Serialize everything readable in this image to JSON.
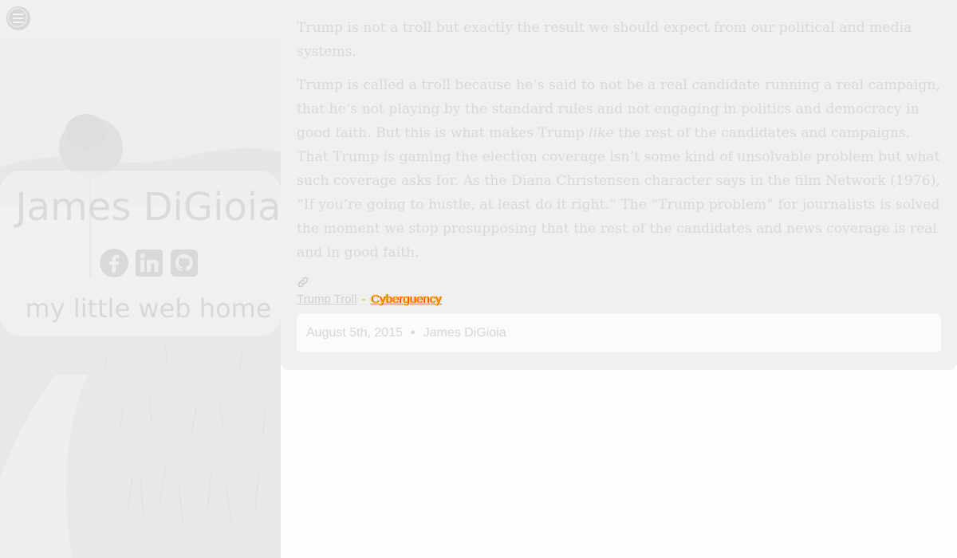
{
  "site": {
    "name": "James DiGioia",
    "tagline": "my little web home",
    "social": [
      {
        "network": "Facebook",
        "icon": "facebook-icon"
      },
      {
        "network": "LinkedIn",
        "icon": "linkedin-icon"
      },
      {
        "network": "GitHub",
        "icon": "github-icon"
      }
    ],
    "menu_icon": "hamburger-menu-icon"
  },
  "post": {
    "paragraphs": [
      {
        "text": "Trump is not a troll but exactly the result we should expect from our political and media systems."
      },
      {
        "before": "Trump is called a troll because he’s said to not be a real candidate running a real campaign, that he’s not playing by the standard rules and not engaging in politics and democracy in good faith. But this is what makes Trump ",
        "emphasis": "like",
        "after": " the rest of the candidates and campaigns. That Trump is gaming the election coverage isn’t some kind of unsolvable problem but what such coverage asks for. As the Diana Christensen character says in the film Network (1976), “If you’re going to hustle, at least do it right.” The “Trump problem” for journalists is solved the moment we stop presupposing that the rest of the candidates and news coverage is real and in good faith."
      }
    ],
    "permalink_icon": "link-icon",
    "tags": [
      {
        "label": "Trump Troll"
      },
      {
        "label": "Cyberguency"
      }
    ],
    "tag_separator": " - ",
    "meta": {
      "date": "August 5th, 2015",
      "separator": "•",
      "author": "James DiGioia"
    }
  },
  "colors": {
    "hero_overlay": "#f0f0f0",
    "card_background": "#f0f0f0",
    "meta_background": "#fbfbfb",
    "text_faded": "#d8d8d8",
    "tag_highlight": "#f0b800"
  }
}
